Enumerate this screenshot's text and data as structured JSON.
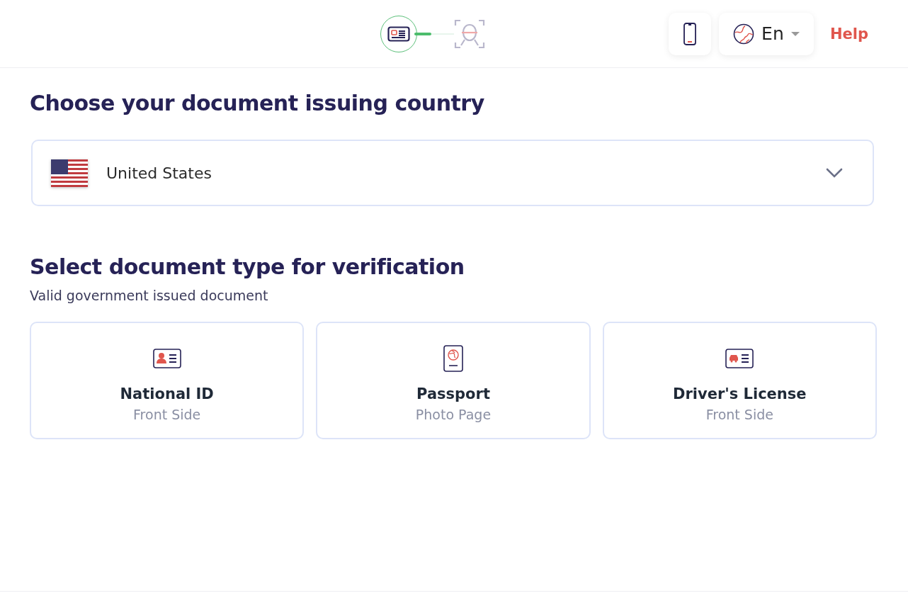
{
  "stepper": {
    "steps": [
      {
        "kind": "document",
        "active": true
      },
      {
        "kind": "face",
        "active": false
      }
    ]
  },
  "header": {
    "language": "En",
    "help": "Help"
  },
  "country_section": {
    "title": "Choose your document issuing country",
    "selected_country": "United States"
  },
  "document_section": {
    "title": "Select document type for verification",
    "subtitle": "Valid government issued document",
    "documents": [
      {
        "kind": "id",
        "title": "National ID",
        "side": "Front Side"
      },
      {
        "kind": "passport",
        "title": "Passport",
        "side": "Photo Page"
      },
      {
        "kind": "license",
        "title": "Driver's License",
        "side": "Front Side"
      }
    ]
  }
}
